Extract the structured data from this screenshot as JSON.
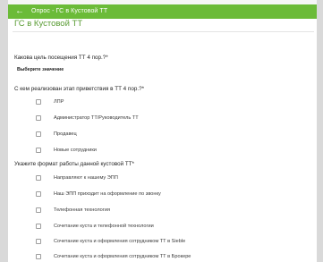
{
  "header": {
    "title": "Опрос - ГС в Кустовой  ТТ",
    "back_icon": "arrow-left-icon",
    "accent_color": "#6bbb38"
  },
  "section_title": "ГС в Кустовой  ТТ",
  "question1": {
    "label": "Какова цель посещения ТТ 4 пор.?*",
    "select_placeholder": "Выберите значение"
  },
  "question2": {
    "label": "С кем реализован  этап приветствия в ТТ  4 пор.?*",
    "options": [
      "ЛПР",
      "Администратор ТТ/Руководитель ТТ",
      "Продавец",
      "Новые сотрудники"
    ]
  },
  "question3": {
    "label": "Укажите формат работы данной кустовой ТТ*",
    "options": [
      "Направляют к нашему ЭПП",
      "Наш ЭПП приходит на оформление по звонку",
      "Телефонная технология",
      "Сочетание куста и телефонной технологии",
      "Сочетание куста и оформления сотрудником ТТ в Sieble",
      "Сочетание куста и оформления сотрудником ТТ в Брокере"
    ]
  }
}
